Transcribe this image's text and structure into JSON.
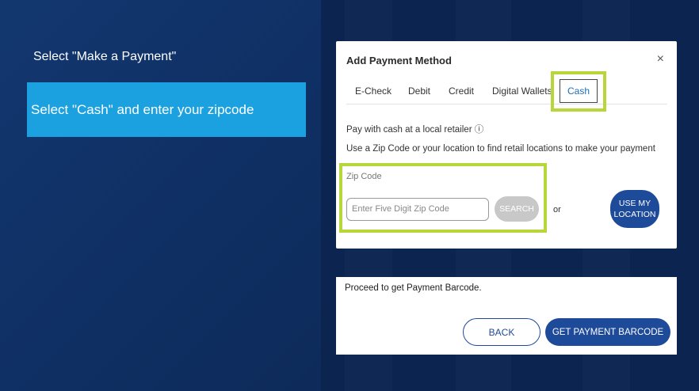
{
  "instructions": {
    "step1": "Select \"Make a Payment\"",
    "step2": "Select \"Cash\" and enter your zipcode"
  },
  "payment_card": {
    "title": "Add Payment Method",
    "close_symbol": "×",
    "tabs": [
      "E-Check",
      "Debit",
      "Credit",
      "Digital Wallets",
      "Cash"
    ],
    "active_tab": "Cash",
    "line1": "Pay with cash at a local retailer ⓘ",
    "line2": "Use a Zip Code or your location to find retail locations to make your payment",
    "zip_label": "Zip Code",
    "zip_placeholder": "Enter Five Digit Zip Code",
    "search_label": "SEARCH",
    "or_text": "or",
    "location_label": "USE MY LOCATION"
  },
  "barcode_card": {
    "proceed_text": "Proceed to get Payment Barcode.",
    "back_label": "BACK",
    "get_barcode_label": "GET PAYMENT BARCODE"
  },
  "colors": {
    "background": "#0f2f63",
    "highlight_blue": "#1ba1e0",
    "highlight_green": "#b6d63a",
    "button_blue": "#1e4a9a"
  }
}
